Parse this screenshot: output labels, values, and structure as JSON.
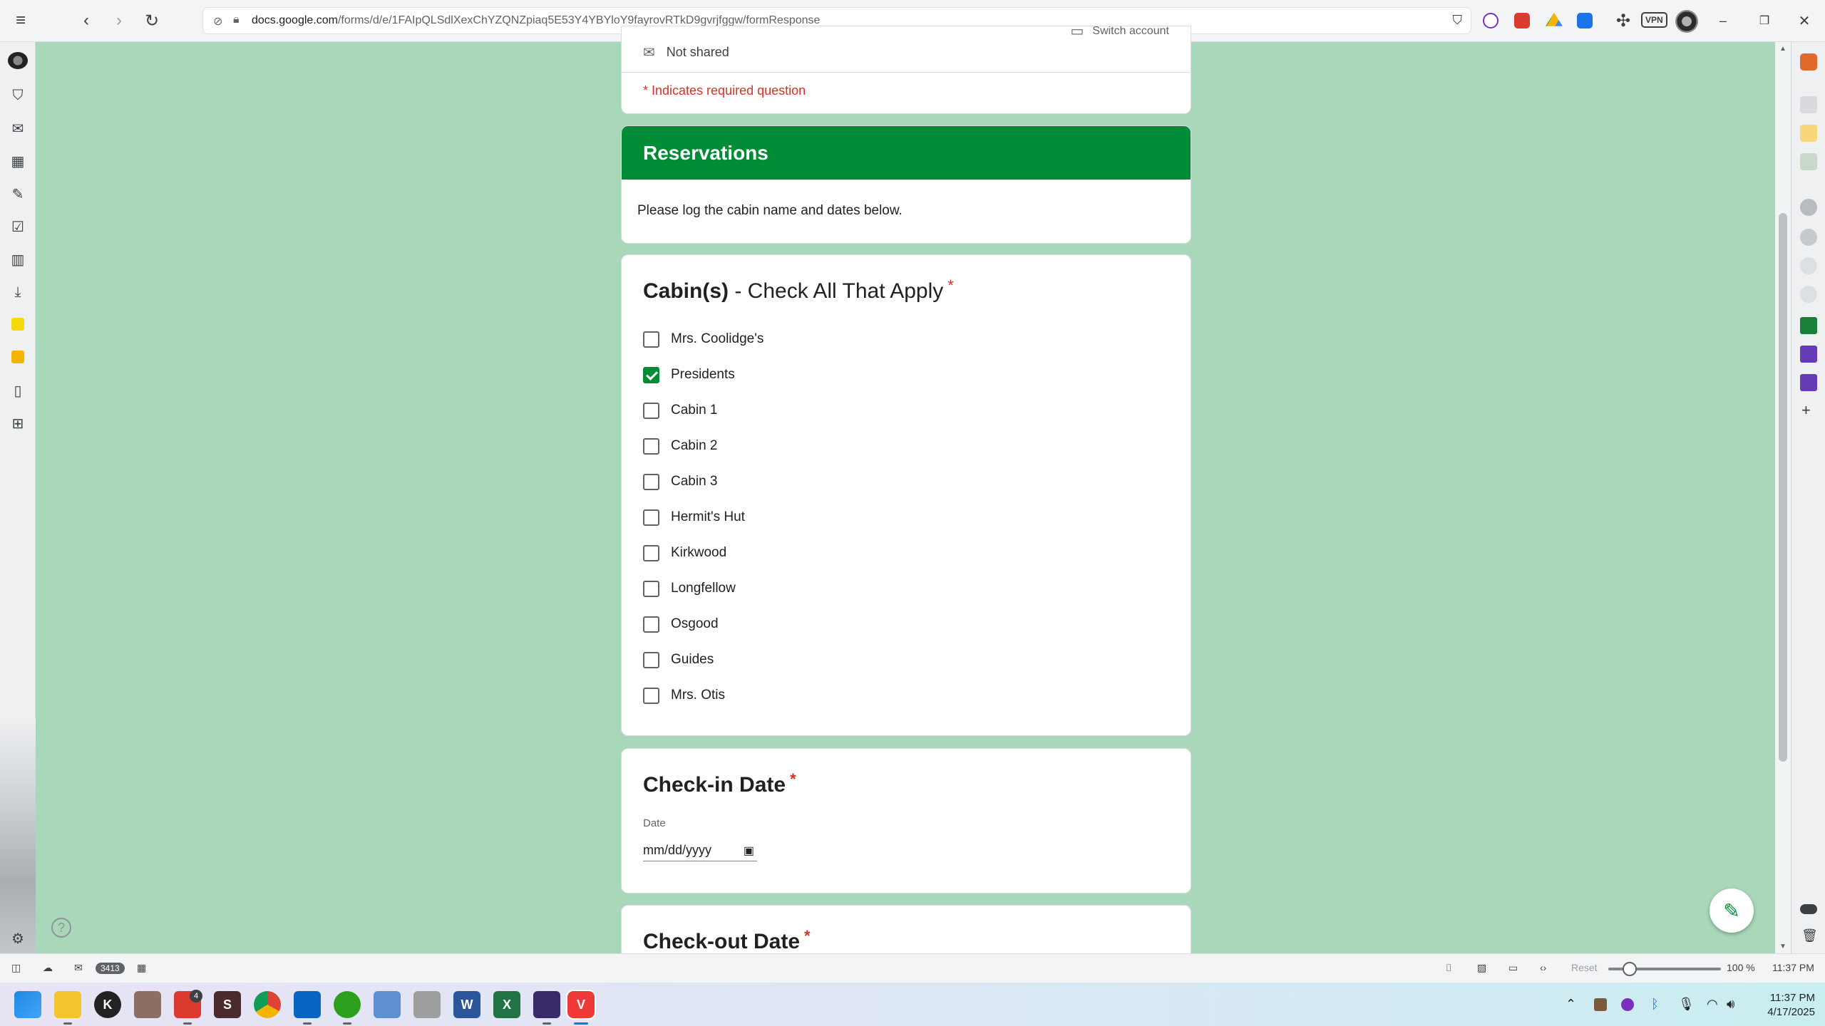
{
  "browser": {
    "url_domain": "docs.google.com",
    "url_path": "/forms/d/e/1FAIpQLSdlXexChYZQNZpiaq5E53Y4YBYloY9fayrovRTkD9gvrjfggw/formResponse",
    "vpn_label": "VPN"
  },
  "form": {
    "account_status": "Not shared",
    "account_status_partial": "Switch account",
    "required_note": "* Indicates required question",
    "section": {
      "title": "Reservations",
      "description": "Please log the cabin name and dates below."
    },
    "cabins_question": {
      "title_bold": "Cabin(s)",
      "title_rest": " - Check All That Apply",
      "required_marker": "*",
      "options": [
        {
          "label": "Mrs. Coolidge's",
          "checked": false
        },
        {
          "label": "Presidents",
          "checked": true
        },
        {
          "label": "Cabin 1",
          "checked": false
        },
        {
          "label": "Cabin 2",
          "checked": false
        },
        {
          "label": "Cabin 3",
          "checked": false
        },
        {
          "label": "Hermit's Hut",
          "checked": false
        },
        {
          "label": "Kirkwood",
          "checked": false
        },
        {
          "label": "Longfellow",
          "checked": false
        },
        {
          "label": "Osgood",
          "checked": false
        },
        {
          "label": "Guides",
          "checked": false
        },
        {
          "label": "Mrs. Otis",
          "checked": false
        }
      ]
    },
    "checkin": {
      "title": "Check-in Date",
      "required_marker": "*",
      "date_label": "Date",
      "date_placeholder": "mm/dd/yyyy"
    },
    "checkout": {
      "title": "Check-out Date",
      "required_marker": "*"
    }
  },
  "statusbar": {
    "mail_count": "3413",
    "reset_label": "Reset",
    "zoom_level": "100 %",
    "time": "11:37 PM"
  },
  "taskbar": {
    "clock_time": "11:37 PM",
    "clock_date": "4/17/2025",
    "todoist_badge": "4"
  },
  "colors": {
    "page_background": "#a8d8b9",
    "accent_green": "#008c36",
    "required_red": "#d93025"
  }
}
